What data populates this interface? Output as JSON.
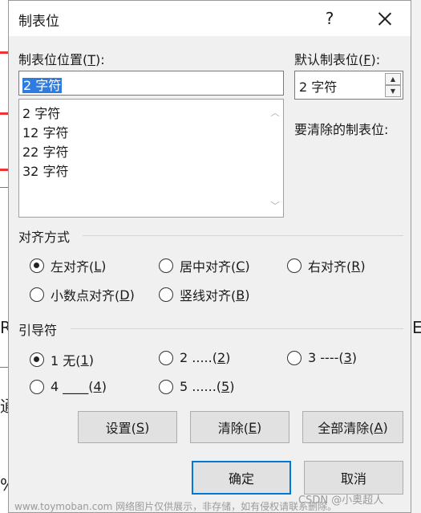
{
  "dialog": {
    "title": "制表位",
    "help_label": "?",
    "tab_stop_position_label": "制表位位置(",
    "tab_stop_position_key": "T",
    "tab_stop_position_suffix": "):",
    "tab_stop_position_value": "2 字符",
    "tab_list": [
      "2 字符",
      "12 字符",
      "22 字符",
      "32 字符"
    ],
    "default_tab_label": "默认制表位(",
    "default_tab_key": "F",
    "default_tab_suffix": "):",
    "default_tab_value": "2 字符",
    "to_clear_label": "要清除的制表位:"
  },
  "alignment": {
    "title": "对齐方式",
    "options": [
      {
        "text": "左对齐(",
        "key": "L",
        "end": ")",
        "checked": true
      },
      {
        "text": "居中对齐(",
        "key": "C",
        "end": ")",
        "checked": false
      },
      {
        "text": "右对齐(",
        "key": "R",
        "end": ")",
        "checked": false
      },
      {
        "text": "小数点对齐(",
        "key": "D",
        "end": ")",
        "checked": false
      },
      {
        "text": "竖线对齐(",
        "key": "B",
        "end": ")",
        "checked": false
      }
    ]
  },
  "leader": {
    "title": "引导符",
    "options": [
      {
        "text": "1 无(",
        "key": "1",
        "end": ")",
        "checked": true
      },
      {
        "text": "2 .....(",
        "key": "2",
        "end": ")",
        "checked": false
      },
      {
        "text": "3 ----(",
        "key": "3",
        "end": ")",
        "checked": false
      },
      {
        "text": "4 ____(",
        "key": "4",
        "end": ")",
        "checked": false
      },
      {
        "text": "5 ......(",
        "key": "5",
        "end": ")",
        "checked": false
      }
    ]
  },
  "buttons": {
    "set": {
      "text": "设置(",
      "key": "S",
      "end": ")"
    },
    "clear": {
      "text": "清除(",
      "key": "E",
      "end": ")"
    },
    "clear_all": {
      "text": "全部清除(",
      "key": "A",
      "end": ")"
    },
    "ok": "确定",
    "cancel": "取消"
  },
  "background": {
    "left_char_1": "R",
    "left_char_2": "通",
    "left_char_3": "%",
    "right_char": "E"
  },
  "watermark": {
    "left": "www.toymoban.com 网络图片仅供展示，非存储，如有侵权请联系删除。",
    "right": "CSDN @小奥超人"
  },
  "colors": {
    "accent": "#0078d7",
    "selection": "#2f7ce0"
  }
}
